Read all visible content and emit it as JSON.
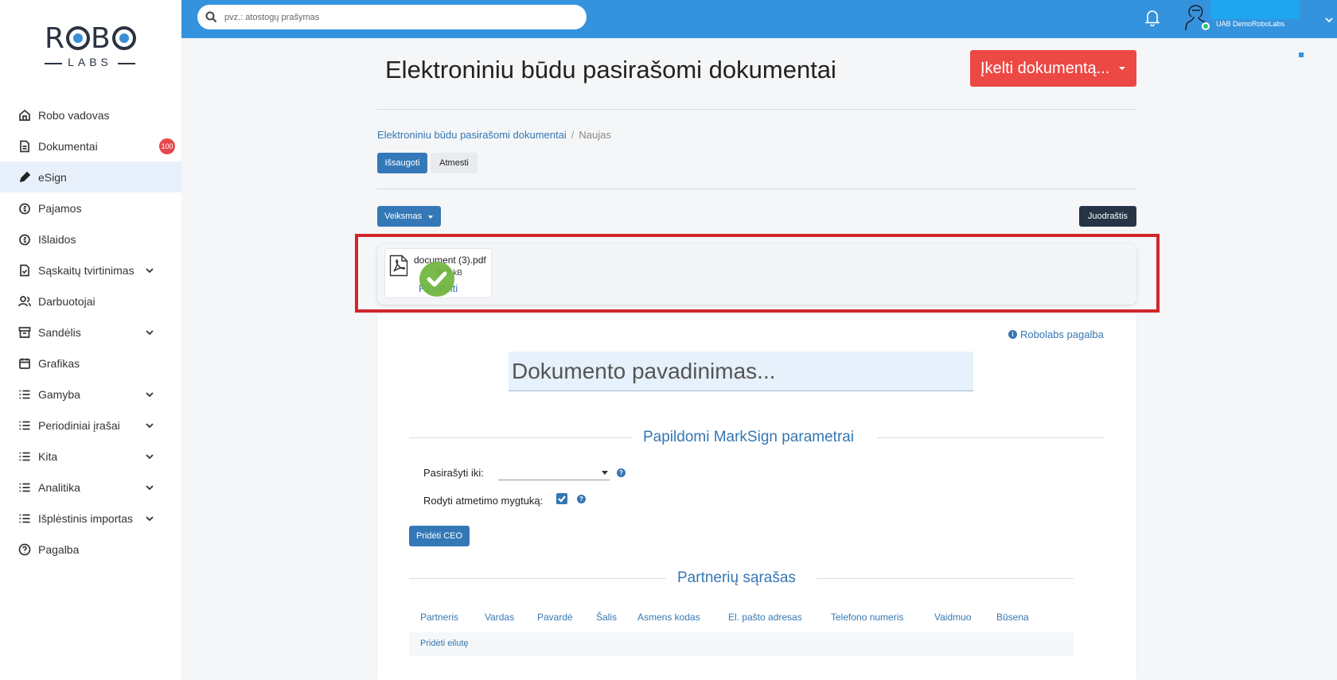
{
  "sidebar": {
    "logo_top": "ROBO",
    "logo_bottom": "LABS",
    "items": [
      {
        "label": "Robo vadovas",
        "icon": "home-icon"
      },
      {
        "label": "Dokumentai",
        "icon": "document-icon",
        "badge": "100"
      },
      {
        "label": "eSign",
        "icon": "pen-icon",
        "active": true
      },
      {
        "label": "Pajamos",
        "icon": "income-icon"
      },
      {
        "label": "Išlaidos",
        "icon": "expense-icon"
      },
      {
        "label": "Sąskaitų tvirtinimas",
        "icon": "file-check-icon",
        "expandable": true
      },
      {
        "label": "Darbuotojai",
        "icon": "users-icon"
      },
      {
        "label": "Sandėlis",
        "icon": "archive-icon",
        "expandable": true
      },
      {
        "label": "Grafikas",
        "icon": "calendar-icon"
      },
      {
        "label": "Gamyba",
        "icon": "list-icon",
        "expandable": true
      },
      {
        "label": "Periodiniai įrašai",
        "icon": "list-icon",
        "expandable": true
      },
      {
        "label": "Kita",
        "icon": "list-icon",
        "expandable": true
      },
      {
        "label": "Analitika",
        "icon": "list-icon",
        "expandable": true
      },
      {
        "label": "Išplėstinis importas",
        "icon": "list-icon",
        "expandable": true
      },
      {
        "label": "Pagalba",
        "icon": "help-circle-icon"
      }
    ]
  },
  "topbar": {
    "search_placeholder": "pvz.: atostogų prašymas",
    "company": "UAB DemoRoboLabs"
  },
  "main": {
    "title": "Elektroniniu būdu pasirašomi dokumentai",
    "upload_button": "Įkelti dokumentą...",
    "breadcrumb": {
      "parent": "Elektroniniu būdu pasirašomi dokumentai",
      "separator": "/",
      "current": "Naujas"
    },
    "tabs": {
      "saved": "Išsaugoti",
      "rejected": "Atmesti"
    },
    "action_button": "Veiksmas",
    "draft_button": "Juodraštis",
    "attachment": {
      "file_name": "document (3).pdf",
      "file_size": "39.2 kB",
      "delete_label": "Pašalinti"
    },
    "help_link": "Robolabs pagalba",
    "doc_name_placeholder": "Dokumento pavadinimas...",
    "marksign": {
      "title": "Papildomi MarkSign parametrai",
      "sign_until_label": "Pasirašyti iki:",
      "show_reject_label": "Rodyti atmetimo mygtuką:",
      "show_reject_checked": true,
      "add_ceo_button": "Pridėti CEO"
    },
    "partners": {
      "title": "Partnerių sąrašas",
      "columns": [
        "Partneris",
        "Vardas",
        "Pavardė",
        "Šalis",
        "Asmens kodas",
        "El. pašto adresas",
        "Telefono numeris",
        "Vaidmuo",
        "Būsena"
      ],
      "add_row": "Pridėti eilutę"
    }
  },
  "colors": {
    "topbar": "#3593de",
    "primary": "#3478b8",
    "danger": "#ec4844",
    "dark": "#263446",
    "highlight": "#d0262b"
  }
}
